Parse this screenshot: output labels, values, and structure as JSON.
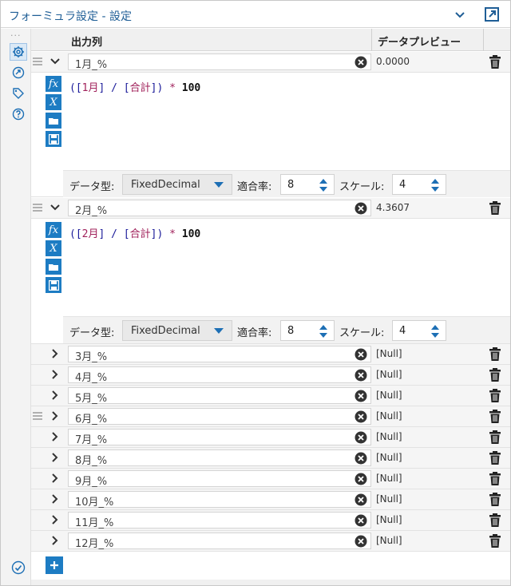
{
  "window": {
    "title": "フォーミュラ設定 - 設定"
  },
  "header": {
    "col_output": "出力列",
    "col_preview": "データプレビュー"
  },
  "expanded": [
    {
      "name": "1月_%",
      "preview": "0.0000",
      "expr": {
        "open": "([",
        "field": "1月",
        "mid": "] / [",
        "field2": "合計",
        "close": "])",
        "op": " * ",
        "num": "100"
      },
      "type_label": "データ型:",
      "type_value": "FixedDecimal",
      "size_label": "適合率:",
      "size_value": "8",
      "scale_label": "スケール:",
      "scale_value": "4"
    },
    {
      "name": "2月_%",
      "preview": "4.3607",
      "expr": {
        "open": "([",
        "field": "2月",
        "mid": "] / [",
        "field2": "合計",
        "close": "])",
        "op": " * ",
        "num": "100"
      },
      "type_label": "データ型:",
      "type_value": "FixedDecimal",
      "size_label": "適合率:",
      "size_value": "8",
      "scale_label": "スケール:",
      "scale_value": "4"
    }
  ],
  "collapsed": [
    {
      "name": "3月_%",
      "preview": "[Null]"
    },
    {
      "name": "4月_%",
      "preview": "[Null]"
    },
    {
      "name": "5月_%",
      "preview": "[Null]"
    },
    {
      "name": "6月_%",
      "preview": "[Null]"
    },
    {
      "name": "7月_%",
      "preview": "[Null]"
    },
    {
      "name": "8月_%",
      "preview": "[Null]"
    },
    {
      "name": "9月_%",
      "preview": "[Null]"
    },
    {
      "name": "10月_%",
      "preview": "[Null]"
    },
    {
      "name": "11月_%",
      "preview": "[Null]"
    },
    {
      "name": "12月_%",
      "preview": "[Null]"
    }
  ],
  "leftbar_icons": [
    "settings-icon",
    "navigate-icon",
    "tag-icon",
    "help-icon"
  ],
  "colors": {
    "accent": "#1d7cc3",
    "title": "#1f5e96"
  }
}
